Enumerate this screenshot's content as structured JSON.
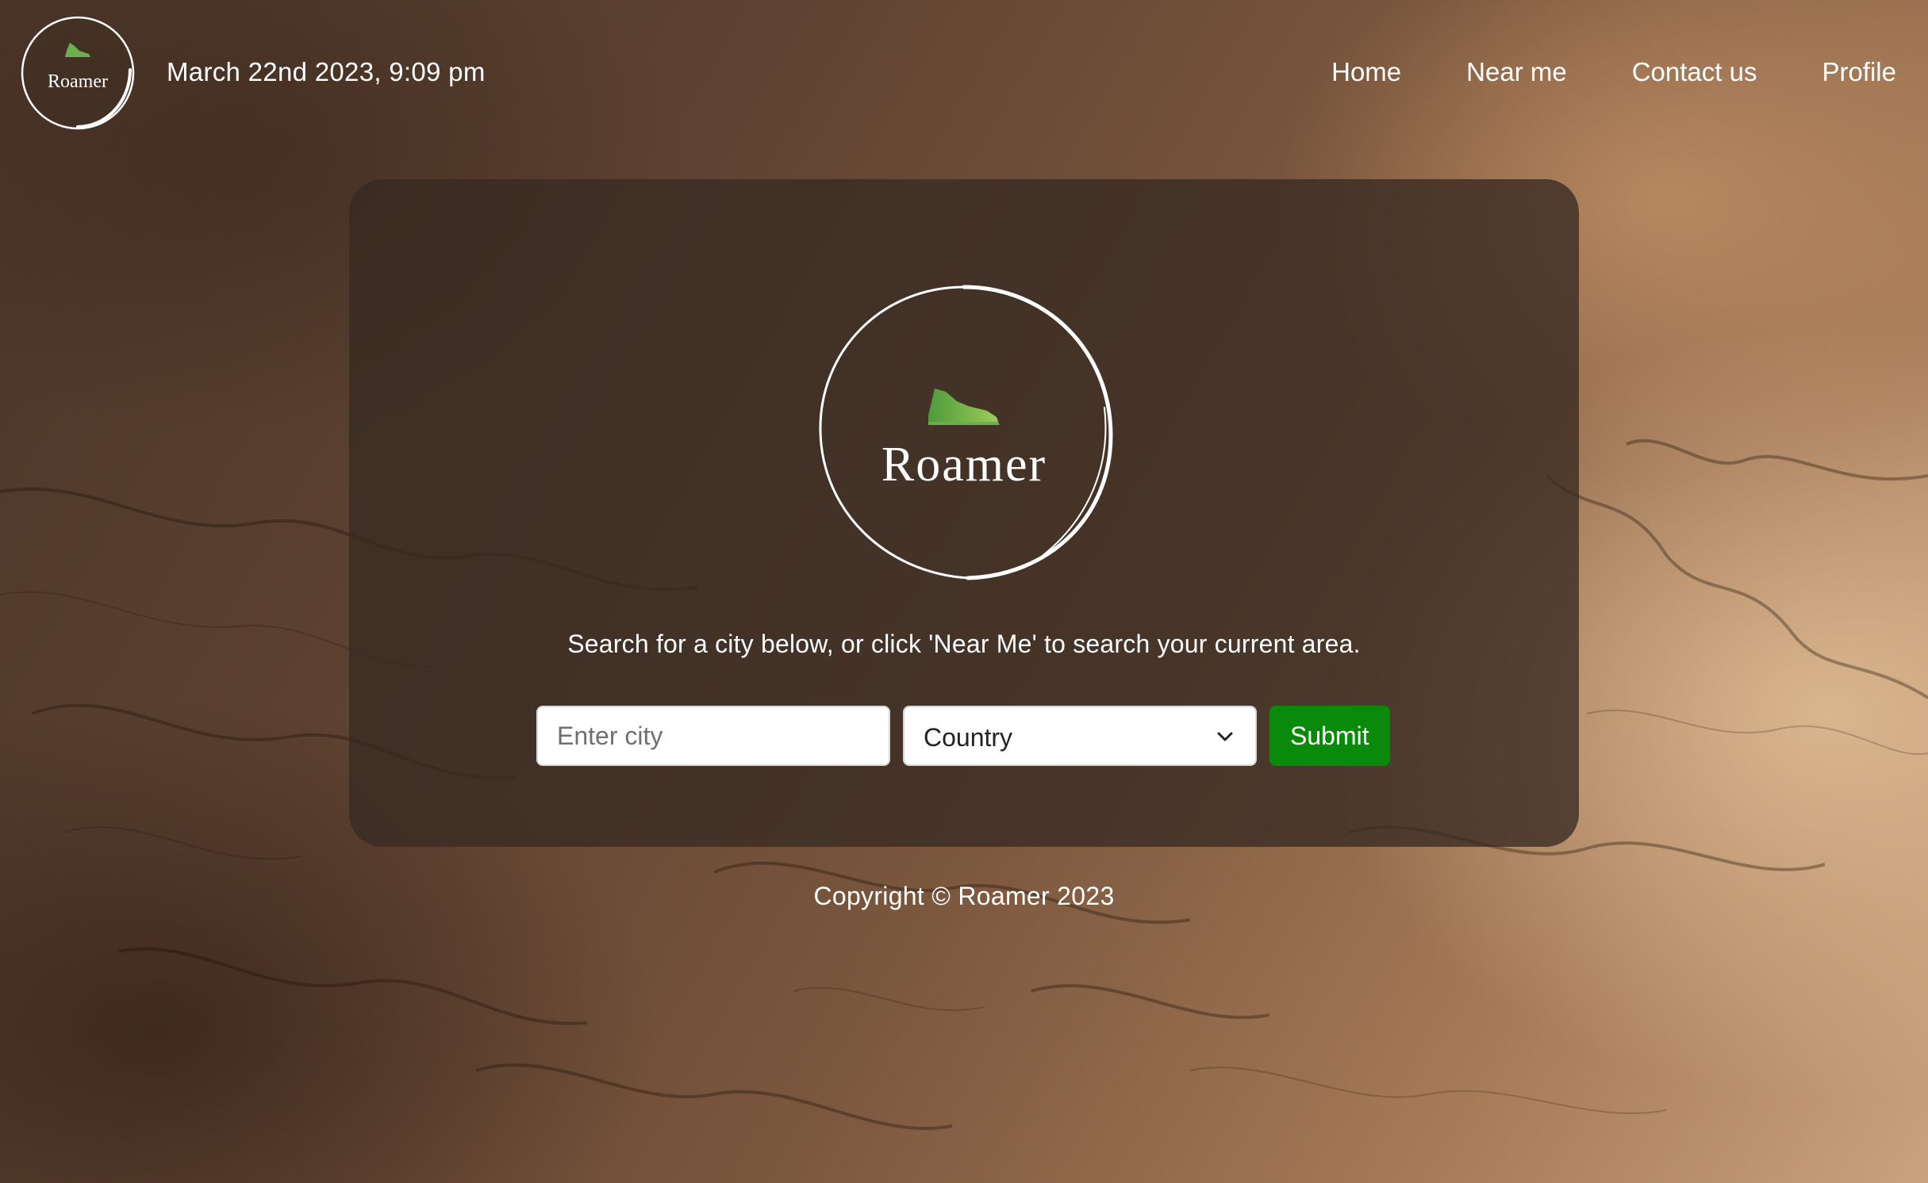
{
  "header": {
    "logo_text": "Roamer",
    "date": "March 22nd 2023, 9:09 pm",
    "nav": [
      {
        "label": "Home"
      },
      {
        "label": "Near me"
      },
      {
        "label": "Contact us"
      },
      {
        "label": "Profile"
      }
    ]
  },
  "card": {
    "logo_text": "Roamer",
    "instructions": "Search for a city below, or click 'Near Me' to search your current area.",
    "city_input": {
      "value": "",
      "placeholder": "Enter city"
    },
    "country_select": {
      "selected": "Country"
    },
    "submit_label": "Submit"
  },
  "footer": {
    "copyright": "Copyright © Roamer 2023"
  },
  "colors": {
    "submit_green": "#0a8a0a",
    "shoe_green": "#6ab04c",
    "card_overlay": "rgba(55,42,34,0.78)"
  },
  "icons": {
    "logo": "sneaker-circle-logo",
    "dropdown": "chevron-down-icon"
  }
}
